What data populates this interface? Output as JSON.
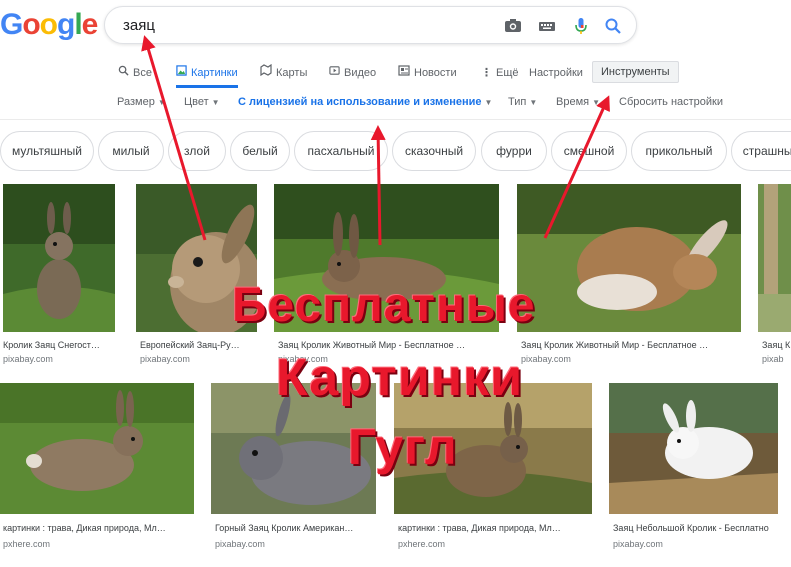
{
  "logo": {
    "letters": [
      "G",
      "o",
      "o",
      "g",
      "l",
      "e"
    ],
    "colors": [
      "#4285f4",
      "#ea4335",
      "#fbbc05",
      "#4285f4",
      "#34a853",
      "#ea4335"
    ]
  },
  "search": {
    "query": "заяц",
    "icons": [
      "camera-icon",
      "keyboard-icon",
      "mic-icon",
      "search-icon"
    ]
  },
  "tabs": [
    {
      "label": "Все",
      "icon": "search-icon"
    },
    {
      "label": "Картинки",
      "icon": "image-icon",
      "active": true
    },
    {
      "label": "Карты",
      "icon": "map-icon"
    },
    {
      "label": "Видео",
      "icon": "video-icon"
    },
    {
      "label": "Новости",
      "icon": "news-icon"
    },
    {
      "label": "Ещё",
      "icon": "more-icon"
    },
    {
      "label": "Настройки"
    },
    {
      "label": "Инструменты",
      "tools": true
    }
  ],
  "filters": [
    {
      "label": "Размер",
      "caret": true
    },
    {
      "label": "Цвет",
      "caret": true
    },
    {
      "label": "С лицензией на использование и изменение",
      "caret": true,
      "highlight": true
    },
    {
      "label": "Тип",
      "caret": true
    },
    {
      "label": "Время",
      "caret": true
    },
    {
      "label": "Сбросить настройки"
    }
  ],
  "chips": [
    "мультяшный",
    "милый",
    "злой",
    "белый",
    "пасхальный",
    "сказочный",
    "фурри",
    "смешной",
    "прикольный",
    "страшный"
  ],
  "results": [
    {
      "caption": "Кролик Заяц Снегост…",
      "source": "pixabay.com"
    },
    {
      "caption": "Европейский Заяц-Ру…",
      "source": "pixabay.com"
    },
    {
      "caption": "Заяц Кролик Животный Мир - Бесплатное …",
      "source": "pixabay.com"
    },
    {
      "caption": "Заяц Кролик Животный Мир - Бесплатное …",
      "source": "pixabay.com"
    },
    {
      "caption": "Заяц К",
      "source": "pixab"
    },
    {
      "caption": "картинки : трава, Дикая природа, Мл…",
      "source": "pxhere.com"
    },
    {
      "caption": "Горный Заяц Кролик Американ…",
      "source": "pixabay.com"
    },
    {
      "caption": "картинки : трава, Дикая природа, Мл…",
      "source": "pxhere.com"
    },
    {
      "caption": "Заяц Небольшой Кролик - Бесплатно",
      "source": "pixabay.com"
    }
  ],
  "overlay": {
    "line1": "Бесплатные",
    "line2": "Картинки",
    "line3": "Гугл",
    "color": "#e8182c"
  },
  "colors": {
    "accent": "#1a73e8",
    "arrow": "#e8182c"
  }
}
